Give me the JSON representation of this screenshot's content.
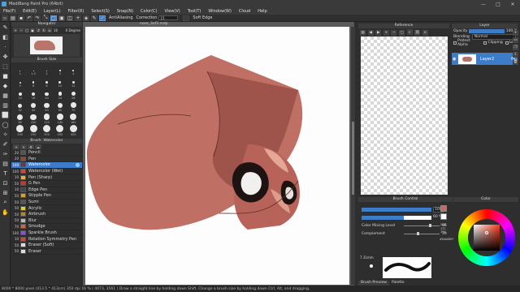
{
  "titlebar": {
    "title": "MediBang Paint Pro (64bit)",
    "minimize": "—",
    "maximize": "□",
    "close": "✕"
  },
  "menu": [
    "File(F)",
    "Edit(E)",
    "Layer(L)",
    "Filter(R)",
    "Select(S)",
    "Snap(N)",
    "Color(C)",
    "View(V)",
    "Tool(T)",
    "Window(W)",
    "Cloud",
    "Help"
  ],
  "toolbar": {
    "antialiasing_label": "AntiAliasing",
    "correction_label": "Correction",
    "correction_value": "15",
    "soft_edge_label": "Soft Edge"
  },
  "canvas": {
    "tab": "nose_3of3.mdp"
  },
  "navigator": {
    "title": "Navigator",
    "zoom_value": "16",
    "angle_value": "0 Degree"
  },
  "brush_size": {
    "title": "Brush Size",
    "sizes": [
      "1",
      "1.5",
      "2",
      "3",
      "4",
      "5",
      "6",
      "8",
      "10",
      "12",
      "14",
      "16",
      "20",
      "24",
      "28",
      "32",
      "40",
      "50",
      "60",
      "70",
      "80",
      "100",
      "120",
      "140",
      "160",
      "200",
      "250",
      "300",
      "400",
      "500"
    ]
  },
  "brush_list": {
    "title": "Brush: Watercolor",
    "items": [
      {
        "size": "20",
        "label": "Pencil",
        "color": "#555555"
      },
      {
        "size": "20",
        "label": "Pen",
        "color": "#8b4a3d"
      },
      {
        "size": "100",
        "label": "Watercolor",
        "color": "#6a3a35",
        "selected": true
      },
      {
        "size": "100",
        "label": "Watercolor (Wet)",
        "color": "#c84a3a"
      },
      {
        "size": "10",
        "label": "Pen (Sharp)",
        "color": "#e0b050"
      },
      {
        "size": "50",
        "label": "G Pen",
        "color": "#cc3333"
      },
      {
        "size": "10",
        "label": "Edge Pen",
        "color": "#444444"
      },
      {
        "size": "50",
        "label": "Stipple Pen",
        "color": "#d8a030"
      },
      {
        "size": "50",
        "label": "Sumi",
        "color": "#555555"
      },
      {
        "size": "50",
        "label": "Acrylic",
        "color": "#ddcc44"
      },
      {
        "size": "50",
        "label": "Airbrush",
        "color": "#aa8844"
      },
      {
        "size": "50",
        "label": "Blur",
        "color": "#bbbbbb"
      },
      {
        "size": "70",
        "label": "Smudge",
        "color": "#cc6644"
      },
      {
        "size": "100",
        "label": "Sparkle Brush",
        "color": "#8855cc"
      },
      {
        "size": "10",
        "label": "Rotation Symmetry Pen",
        "color": "#c84a3a"
      },
      {
        "size": "50",
        "label": "Eraser (Soft)",
        "color": "#dddddd"
      },
      {
        "size": "50",
        "label": "Eraser",
        "color": "#dddddd"
      }
    ]
  },
  "reference": {
    "title": "Reference"
  },
  "layer": {
    "title": "Layer",
    "opacity_label": "Opacity",
    "opacity_value": "100 %",
    "blending_label": "Blending",
    "blending_value": "Normal",
    "protect_alpha": "Protect Alpha",
    "clipping": "Clipping",
    "lock": "Lock",
    "layer_name": "Layer2"
  },
  "brush_control": {
    "title": "Brush Control",
    "size_value": "100",
    "opacity_value": "60 %",
    "mixing_label": "Color Mixing Level",
    "mixing_value": "66",
    "complement_label": "Complement",
    "complement_value": "39"
  },
  "brush_preview": {
    "title": "Brush Preview",
    "size_value": "7.31mm",
    "tab2": "Palette"
  },
  "color": {
    "title": "Color",
    "current": "#c66b5f",
    "hex": "#DAAB97",
    "rgb_values": [
      "218",
      "171",
      "151"
    ]
  },
  "statusbar": {
    "text": "8000 * 8000 pixel   (413.5 * 413cm)   350 dpi   16 %   ( 4073, 3561 )   Draw a straight line by holding down Shift. Change a brush size by holding down Ctrl, Alt, and dragging."
  }
}
